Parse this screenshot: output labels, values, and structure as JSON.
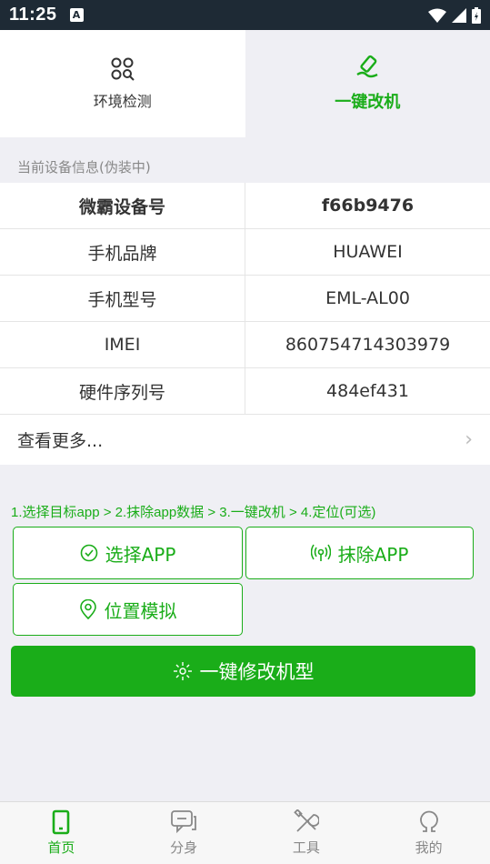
{
  "status_bar": {
    "time": "11:25",
    "badge": "A"
  },
  "top_tabs": [
    {
      "label": "环境检测",
      "icon": "grid-search-icon",
      "active": false
    },
    {
      "label": "一键改机",
      "icon": "brush-icon",
      "active": true
    }
  ],
  "device_info": {
    "section_title": "当前设备信息(伪装中)",
    "rows": [
      {
        "key": "微霸设备号",
        "value": "f66b9476"
      },
      {
        "key": "手机品牌",
        "value": "HUAWEI"
      },
      {
        "key": "手机型号",
        "value": "EML-AL00"
      },
      {
        "key": "IMEI",
        "value": "860754714303979"
      },
      {
        "key": "硬件序列号",
        "value": "484ef431"
      }
    ],
    "more_label": "查看更多..."
  },
  "steps_text": "1.选择目标app > 2.抹除app数据 > 3.一键改机 > 4.定位(可选)",
  "actions": {
    "select_app": "选择APP",
    "wipe_app": "抹除APP",
    "location_mock": "位置模拟",
    "one_key_modify": "一键修改机型"
  },
  "bottom_nav": [
    {
      "label": "首页",
      "icon": "phone-icon",
      "active": true
    },
    {
      "label": "分身",
      "icon": "chat-icon",
      "active": false
    },
    {
      "label": "工具",
      "icon": "tools-icon",
      "active": false
    },
    {
      "label": "我的",
      "icon": "user-icon",
      "active": false
    }
  ],
  "colors": {
    "accent": "#1aad19",
    "status_bar": "#1e2a35",
    "background": "#efeff4"
  }
}
